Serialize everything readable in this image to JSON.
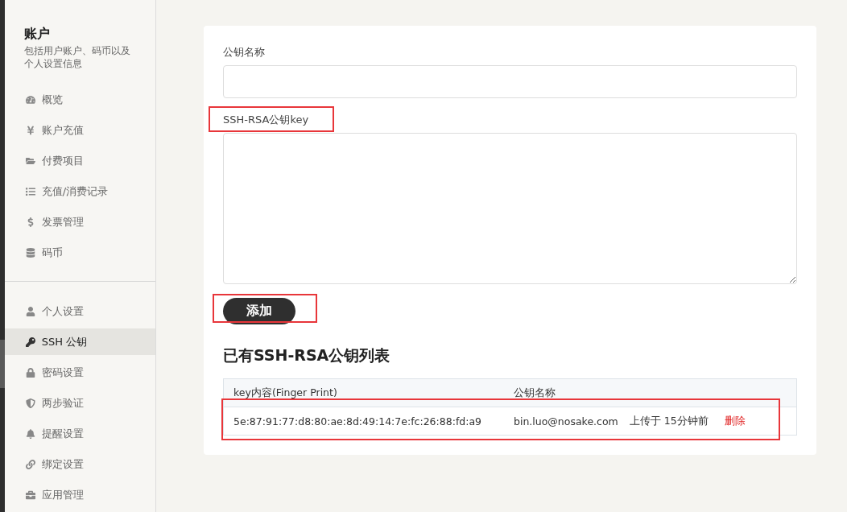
{
  "sidebar": {
    "title": "账户",
    "subtitle": "包括用户账户、码币以及个人设置信息",
    "groups": [
      [
        {
          "label": "概览",
          "selected": false
        },
        {
          "label": "账户充值",
          "selected": false
        },
        {
          "label": "付费项目",
          "selected": false
        },
        {
          "label": "充值/消费记录",
          "selected": false
        },
        {
          "label": "发票管理",
          "selected": false
        },
        {
          "label": "码币",
          "selected": false
        }
      ],
      [
        {
          "label": "个人设置",
          "selected": false
        },
        {
          "label": "SSH 公钥",
          "selected": true
        },
        {
          "label": "密码设置",
          "selected": false
        },
        {
          "label": "两步验证",
          "selected": false
        },
        {
          "label": "提醒设置",
          "selected": false
        },
        {
          "label": "绑定设置",
          "selected": false
        },
        {
          "label": "应用管理",
          "selected": false
        }
      ]
    ]
  },
  "form": {
    "name_label": "公钥名称",
    "key_label": "SSH-RSA公钥key",
    "submit": "添加"
  },
  "list": {
    "title": "已有SSH-RSA公钥列表",
    "columns": [
      "key内容(Finger Print)",
      "公钥名称"
    ],
    "rows": [
      {
        "fingerprint": "5e:87:91:77:d8:80:ae:8d:49:14:7e:fc:26:88:fd:a9",
        "name": "bin.luo@nosake.com",
        "uploaded": "上传于 15分钟前",
        "action": "删除"
      }
    ]
  }
}
